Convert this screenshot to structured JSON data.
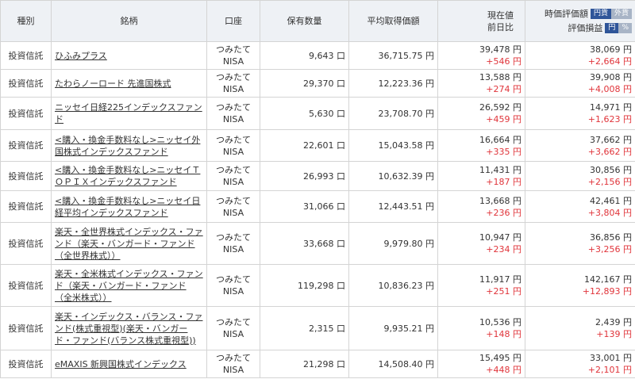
{
  "header": {
    "type": "種別",
    "name": "銘柄",
    "account": "口座",
    "quantity": "保有数量",
    "avg_cost": "平均取得価額",
    "price_line1": "現在値",
    "price_line2": "前日比",
    "eval_label": "時価評価額",
    "eval_toggle": [
      "円貨",
      "外貨"
    ],
    "pl_label": "評価損益",
    "pl_toggle": [
      "円",
      "%"
    ]
  },
  "rows": [
    {
      "type": "投資信託",
      "name": "ひふみプラス",
      "account": [
        "つみたて",
        "NISA"
      ],
      "quantity": "9,643 口",
      "avg_cost": "36,715.75 円",
      "price": "39,478 円",
      "change": "+546 円",
      "value": "38,069 円",
      "pl": "+2,664 円"
    },
    {
      "type": "投資信託",
      "name": "たわらノーロード 先進国株式",
      "account": [
        "つみたて",
        "NISA"
      ],
      "quantity": "29,370 口",
      "avg_cost": "12,223.36 円",
      "price": "13,588 円",
      "change": "+274 円",
      "value": "39,908 円",
      "pl": "+4,008 円"
    },
    {
      "type": "投資信託",
      "name": "ニッセイ日経225インデックスファンド",
      "account": [
        "つみたて",
        "NISA"
      ],
      "quantity": "5,630 口",
      "avg_cost": "23,708.70 円",
      "price": "26,592 円",
      "change": "+459 円",
      "value": "14,971 円",
      "pl": "+1,623 円"
    },
    {
      "type": "投資信託",
      "name": "<購入・換金手数料なし>ニッセイ外国株式インデックスファンド",
      "account": [
        "つみたて",
        "NISA"
      ],
      "quantity": "22,601 口",
      "avg_cost": "15,043.58 円",
      "price": "16,664 円",
      "change": "+335 円",
      "value": "37,662 円",
      "pl": "+3,662 円"
    },
    {
      "type": "投資信託",
      "name": "<購入・換金手数料なし>ニッセイＴＯＰＩＸインデックスファンド",
      "account": [
        "つみたて",
        "NISA"
      ],
      "quantity": "26,993 口",
      "avg_cost": "10,632.39 円",
      "price": "11,431 円",
      "change": "+187 円",
      "value": "30,856 円",
      "pl": "+2,156 円"
    },
    {
      "type": "投資信託",
      "name": "<購入・換金手数料なし>ニッセイ日経平均インデックスファンド",
      "account": [
        "つみたて",
        "NISA"
      ],
      "quantity": "31,066 口",
      "avg_cost": "12,443.51 円",
      "price": "13,668 円",
      "change": "+236 円",
      "value": "42,461 円",
      "pl": "+3,804 円"
    },
    {
      "type": "投資信託",
      "name": "楽天・全世界株式インデックス・ファンド（楽天・バンガード・ファンド（全世界株式））",
      "account": [
        "つみたて",
        "NISA"
      ],
      "quantity": "33,668 口",
      "avg_cost": "9,979.80 円",
      "price": "10,947 円",
      "change": "+234 円",
      "value": "36,856 円",
      "pl": "+3,256 円"
    },
    {
      "type": "投資信託",
      "name": "楽天・全米株式インデックス・ファンド（楽天・バンガード・ファンド（全米株式））",
      "account": [
        "つみたて",
        "NISA"
      ],
      "quantity": "119,298 口",
      "avg_cost": "10,836.23 円",
      "price": "11,917 円",
      "change": "+251 円",
      "value": "142,167 円",
      "pl": "+12,893 円"
    },
    {
      "type": "投資信託",
      "name": "楽天・インデックス・バランス・ファンド(株式重視型)(楽天・バンガード・ファンド(バランス株式重視型))",
      "account": [
        "つみたて",
        "NISA"
      ],
      "quantity": "2,315 口",
      "avg_cost": "9,935.21 円",
      "price": "10,536 円",
      "change": "+148 円",
      "value": "2,439 円",
      "pl": "+139 円"
    },
    {
      "type": "投資信託",
      "name": "eMAXIS 新興国株式インデックス",
      "account": [
        "つみたて",
        "NISA"
      ],
      "quantity": "21,298 口",
      "avg_cost": "14,508.40 円",
      "price": "15,495 円",
      "change": "+448 円",
      "value": "33,001 円",
      "pl": "+2,101 円"
    }
  ]
}
